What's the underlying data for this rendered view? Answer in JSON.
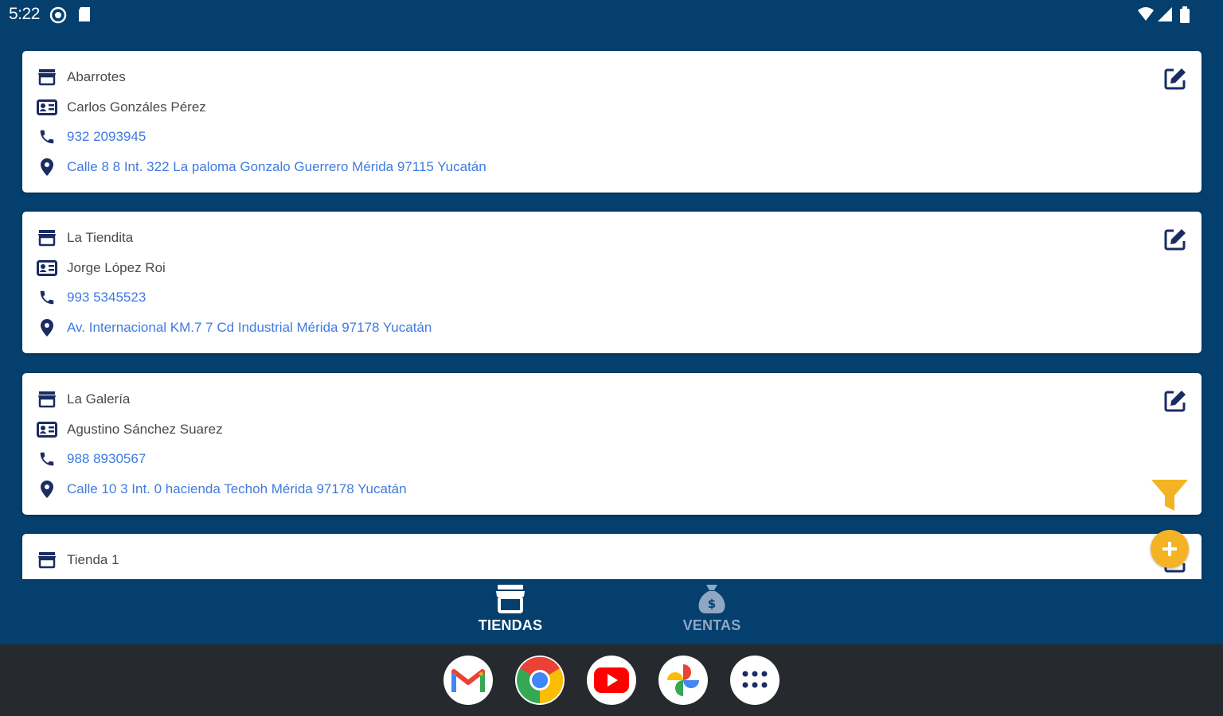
{
  "status_bar": {
    "time": "5:22"
  },
  "stores": [
    {
      "name": "Abarrotes",
      "owner": "Carlos Gonzáles Pérez",
      "phone": "932 2093945",
      "address": "Calle 8 8 Int. 322 La paloma Gonzalo Guerrero Mérida 97115 Yucatán"
    },
    {
      "name": "La Tiendita",
      "owner": "Jorge López Roi",
      "phone": "993 5345523",
      "address": "Av. Internacional KM.7 7  Cd Industrial Mérida 97178 Yucatán"
    },
    {
      "name": "La Galería",
      "owner": "Agustino Sánchez Suarez",
      "phone": "988 8930567",
      "address": "Calle 10 3 Int. 0 hacienda Techoh Mérida 97178 Yucatán"
    },
    {
      "name": "Tienda 1"
    }
  ],
  "bottom_nav": {
    "tiendas_label": "TIENDAS",
    "ventas_label": "VENTAS"
  },
  "colors": {
    "background": "#043f6e",
    "icon_navy": "#1a2c63",
    "link_blue": "#3f7be0",
    "accent_yellow": "#f4b324",
    "nav_inactive": "#8fa7c2"
  },
  "dock_apps": [
    "gmail-icon",
    "chrome-icon",
    "youtube-icon",
    "photos-icon",
    "app-drawer-icon"
  ]
}
